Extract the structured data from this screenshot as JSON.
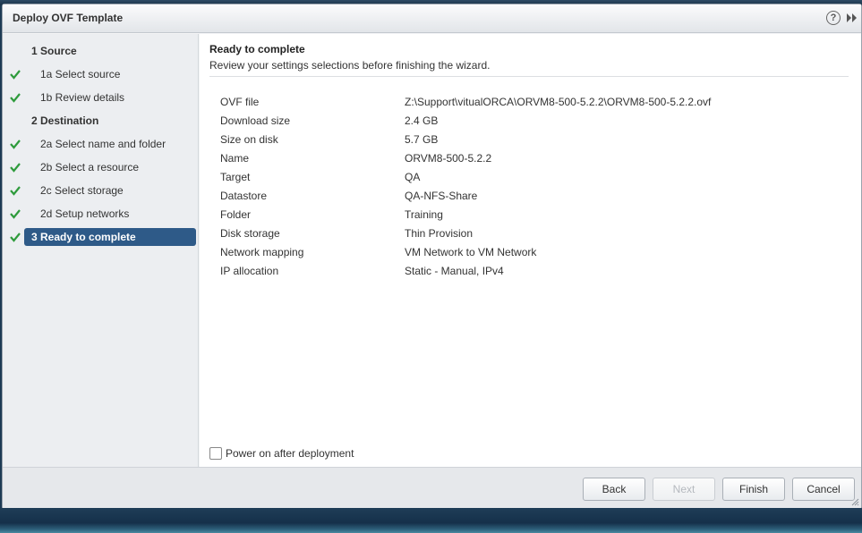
{
  "window": {
    "title": "Deploy OVF Template",
    "help_symbol": "?"
  },
  "colors": {
    "accent": "#2e5a88",
    "check": "#2e9b3c"
  },
  "nav": {
    "items": [
      {
        "label": "1  Source",
        "level": "section",
        "done": false,
        "active": false
      },
      {
        "label": "1a Select source",
        "level": "sub",
        "done": true,
        "active": false
      },
      {
        "label": "1b Review details",
        "level": "sub",
        "done": true,
        "active": false
      },
      {
        "label": "2  Destination",
        "level": "section",
        "done": false,
        "active": false
      },
      {
        "label": "2a Select name and folder",
        "level": "sub",
        "done": true,
        "active": false
      },
      {
        "label": "2b Select a resource",
        "level": "sub",
        "done": true,
        "active": false
      },
      {
        "label": "2c Select storage",
        "level": "sub",
        "done": true,
        "active": false
      },
      {
        "label": "2d Setup networks",
        "level": "sub",
        "done": true,
        "active": false
      },
      {
        "label": "3  Ready to complete",
        "level": "section",
        "done": true,
        "active": true
      }
    ]
  },
  "content": {
    "title": "Ready to complete",
    "subtitle": "Review your settings selections before finishing the wizard.",
    "summary": [
      {
        "key": "OVF file",
        "value": "Z:\\Support\\vitualORCA\\ORVM8-500-5.2.2\\ORVM8-500-5.2.2.ovf"
      },
      {
        "key": "Download size",
        "value": "2.4 GB"
      },
      {
        "key": "Size on disk",
        "value": "5.7 GB"
      },
      {
        "key": "Name",
        "value": "ORVM8-500-5.2.2"
      },
      {
        "key": "Target",
        "value": "QA"
      },
      {
        "key": "Datastore",
        "value": "QA-NFS-Share"
      },
      {
        "key": "Folder",
        "value": "Training"
      },
      {
        "key": "Disk storage",
        "value": "Thin Provision"
      },
      {
        "key": "Network mapping",
        "value": "VM Network to VM Network"
      },
      {
        "key": "IP allocation",
        "value": "Static - Manual, IPv4"
      }
    ],
    "power_on_label": "Power on after deployment",
    "power_on_checked": false
  },
  "footer": {
    "back_label": "Back",
    "next_label": "Next",
    "finish_label": "Finish",
    "cancel_label": "Cancel"
  }
}
